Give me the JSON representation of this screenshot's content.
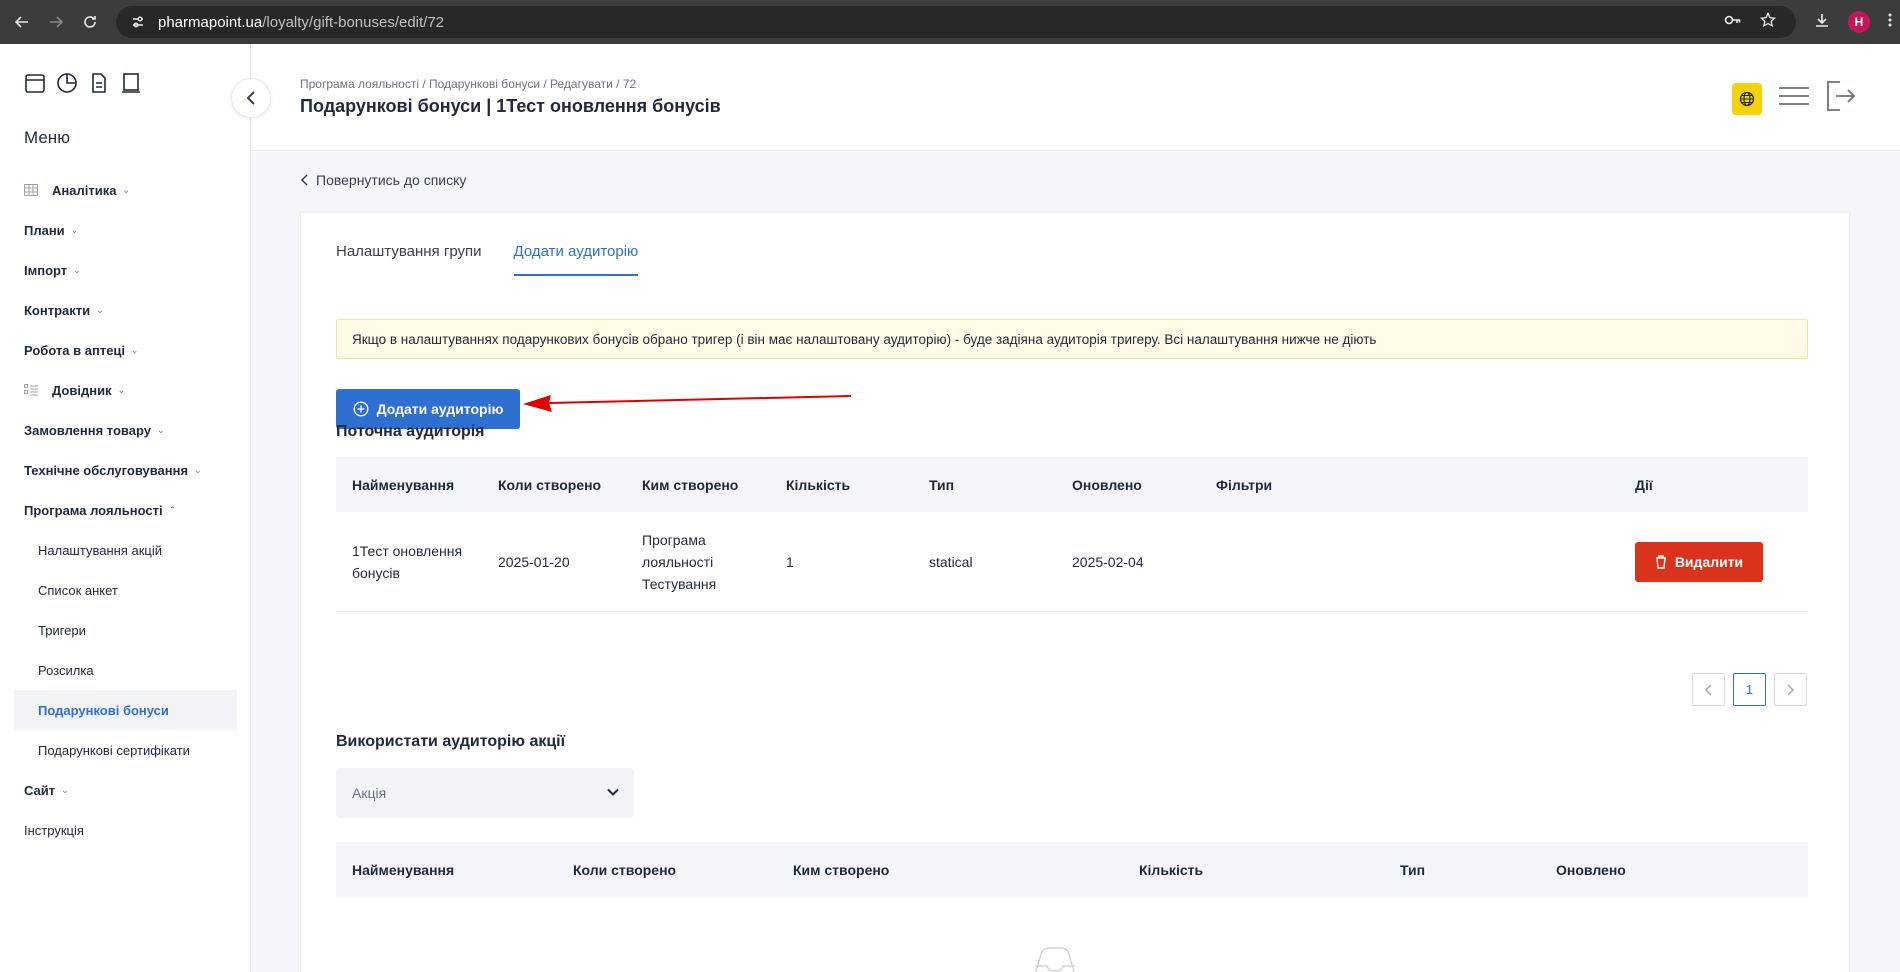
{
  "browser": {
    "url_host": "pharmapoint.ua",
    "url_path": "/loyalty/gift-bonuses/edit/72",
    "avatar_letter": "H"
  },
  "sidebar": {
    "menu_title": "Меню",
    "items": [
      {
        "label": "Аналітика",
        "expanded": false,
        "has_icon": true
      },
      {
        "label": "Плани",
        "expanded": false
      },
      {
        "label": "Імпорт",
        "expanded": false
      },
      {
        "label": "Контракти",
        "expanded": false
      },
      {
        "label": "Робота в аптеці",
        "expanded": false
      },
      {
        "label": "Довідник",
        "expanded": false,
        "has_icon": true
      },
      {
        "label": "Замовлення товару",
        "expanded": false
      },
      {
        "label": "Технічне обслуговування",
        "expanded": false
      },
      {
        "label": "Програма лояльності",
        "expanded": true
      }
    ],
    "loyalty_sub": [
      "Налаштування акцій",
      "Список анкет",
      "Тригери",
      "Розсилка",
      "Подарункові бонуси",
      "Подарункові сертифікати"
    ],
    "active_sub": "Подарункові бонуси",
    "site_label": "Сайт",
    "instructions_label": "Інструкція"
  },
  "header": {
    "breadcrumb": "Програма лояльності / Подарункові бонуси / Редагувати / 72",
    "title": "Подарункові бонуси | 1Тест оновлення бонусів"
  },
  "main": {
    "back_label": "Повернутись до списку",
    "tabs": [
      "Налаштування групи",
      "Додати аудиторію"
    ],
    "active_tab": "Додати аудиторію",
    "alert_text": "Якщо в налаштуваннях подарункових бонусів обрано тригер (і він має налаштовану аудиторію) - буде задіяна аудиторія тригеру. Всі налаштування нижче не діють",
    "add_button_label": "Додати аудиторію",
    "current_audience": {
      "title": "Поточна аудиторія",
      "columns": [
        "Найменування",
        "Коли створено",
        "Ким створено",
        "Кількість",
        "Тип",
        "Оновлено",
        "Фільтри",
        "Дії"
      ],
      "rows": [
        {
          "name": "1Тест оновлення бонусів",
          "created": "2025-01-20",
          "created_by": "Програма лояльності Тестування",
          "count": "1",
          "type": "statical",
          "updated": "2025-02-04",
          "filters": "",
          "action_label": "Видалити"
        }
      ],
      "page": "1"
    },
    "promo_audience": {
      "title": "Використати аудиторію акції",
      "select_placeholder": "Акція",
      "columns": [
        "Найменування",
        "Коли створено",
        "Ким створено",
        "Кількість",
        "Тип",
        "Оновлено"
      ]
    }
  },
  "colors": {
    "accent": "#2f6fd0",
    "danger": "#d9331b",
    "alert_bg": "#fffbe6",
    "globe": "#f5d20a"
  }
}
